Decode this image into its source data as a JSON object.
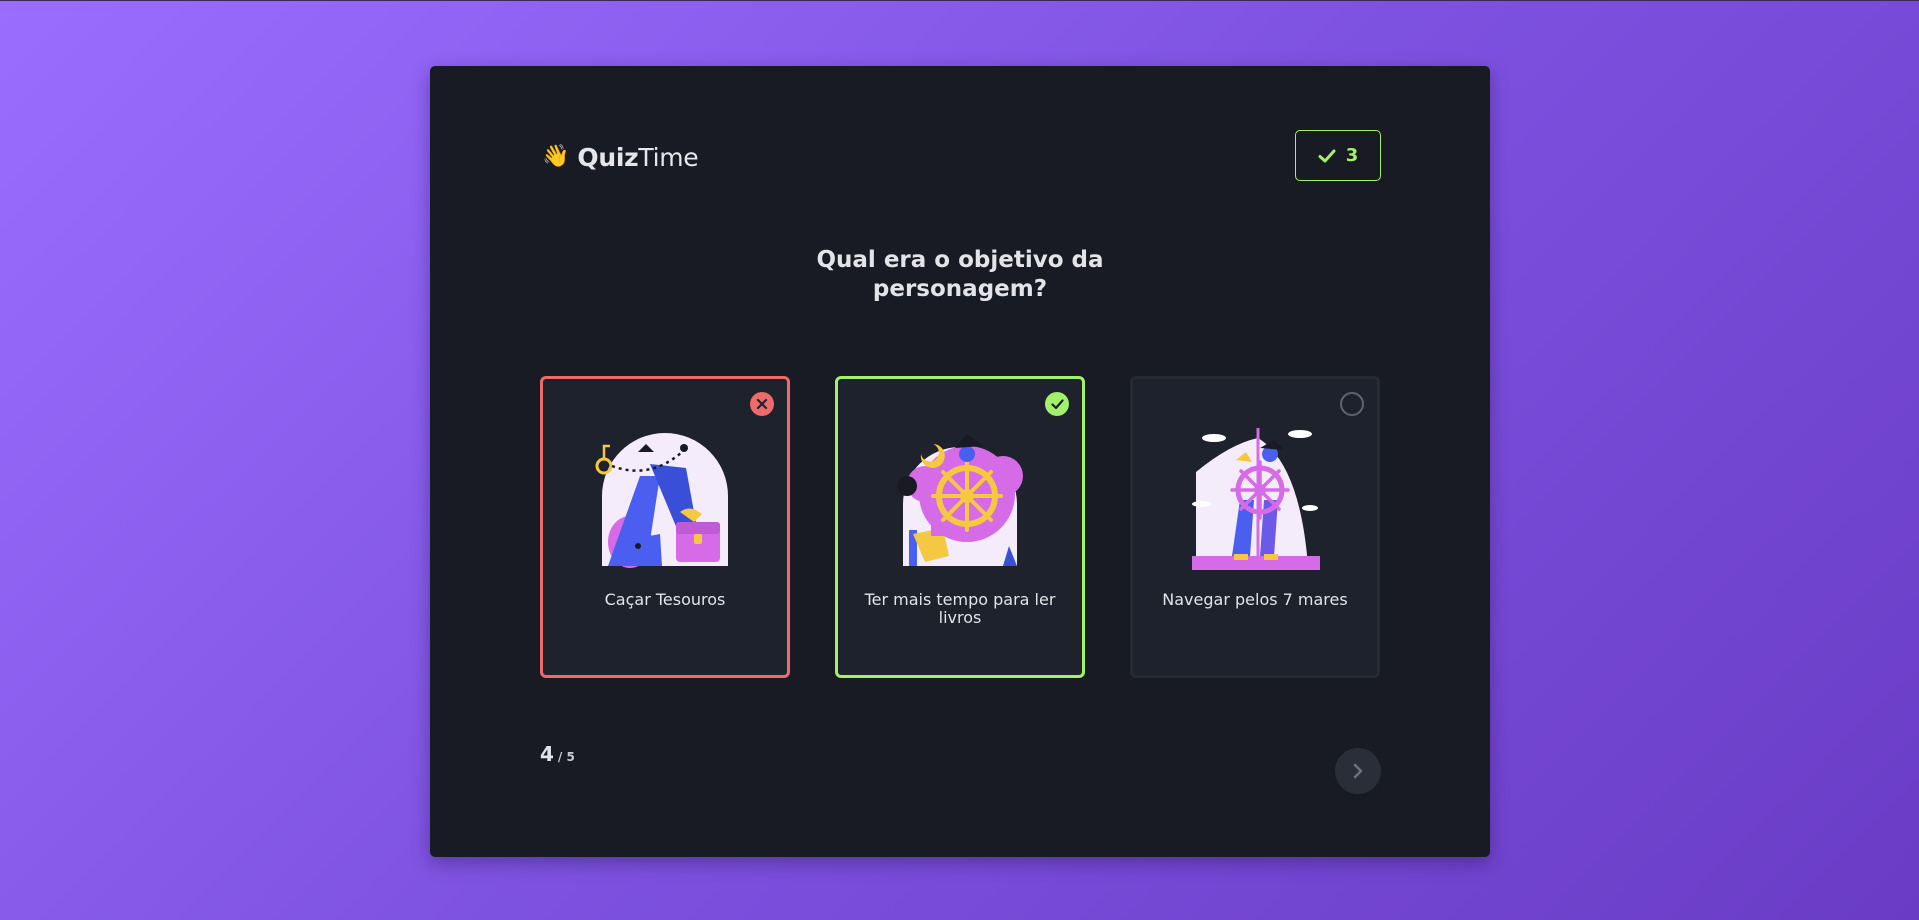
{
  "header": {
    "brand_emoji": "👋",
    "brand_bold": "Quiz",
    "brand_light": "Time",
    "score": "3",
    "score_icon": "check-icon"
  },
  "question": {
    "text": "Qual era o objetivo da personagem?"
  },
  "options": [
    {
      "label": "Caçar Tesouros",
      "state": "wrong",
      "status_icon": "x-icon",
      "illustration": "treasure-hunt-illustration"
    },
    {
      "label": "Ter mais tempo para ler livros",
      "state": "correct",
      "status_icon": "check-icon",
      "illustration": "reading-daydream-illustration"
    },
    {
      "label": "Navegar pelos 7 mares",
      "state": "neutral",
      "status_icon": "empty-circle-icon",
      "illustration": "ship-wheel-illustration"
    }
  ],
  "footer": {
    "current": "4",
    "total": "/ 5",
    "next_icon": "chevron-right-icon"
  },
  "colors": {
    "correct": "#a3f06b",
    "wrong": "#ee6b6b",
    "card_bg": "#181b24",
    "option_bg": "#1e222d",
    "accent_purple": "#d66be8",
    "accent_blue": "#4a5ff0",
    "accent_yellow": "#f5c842"
  }
}
